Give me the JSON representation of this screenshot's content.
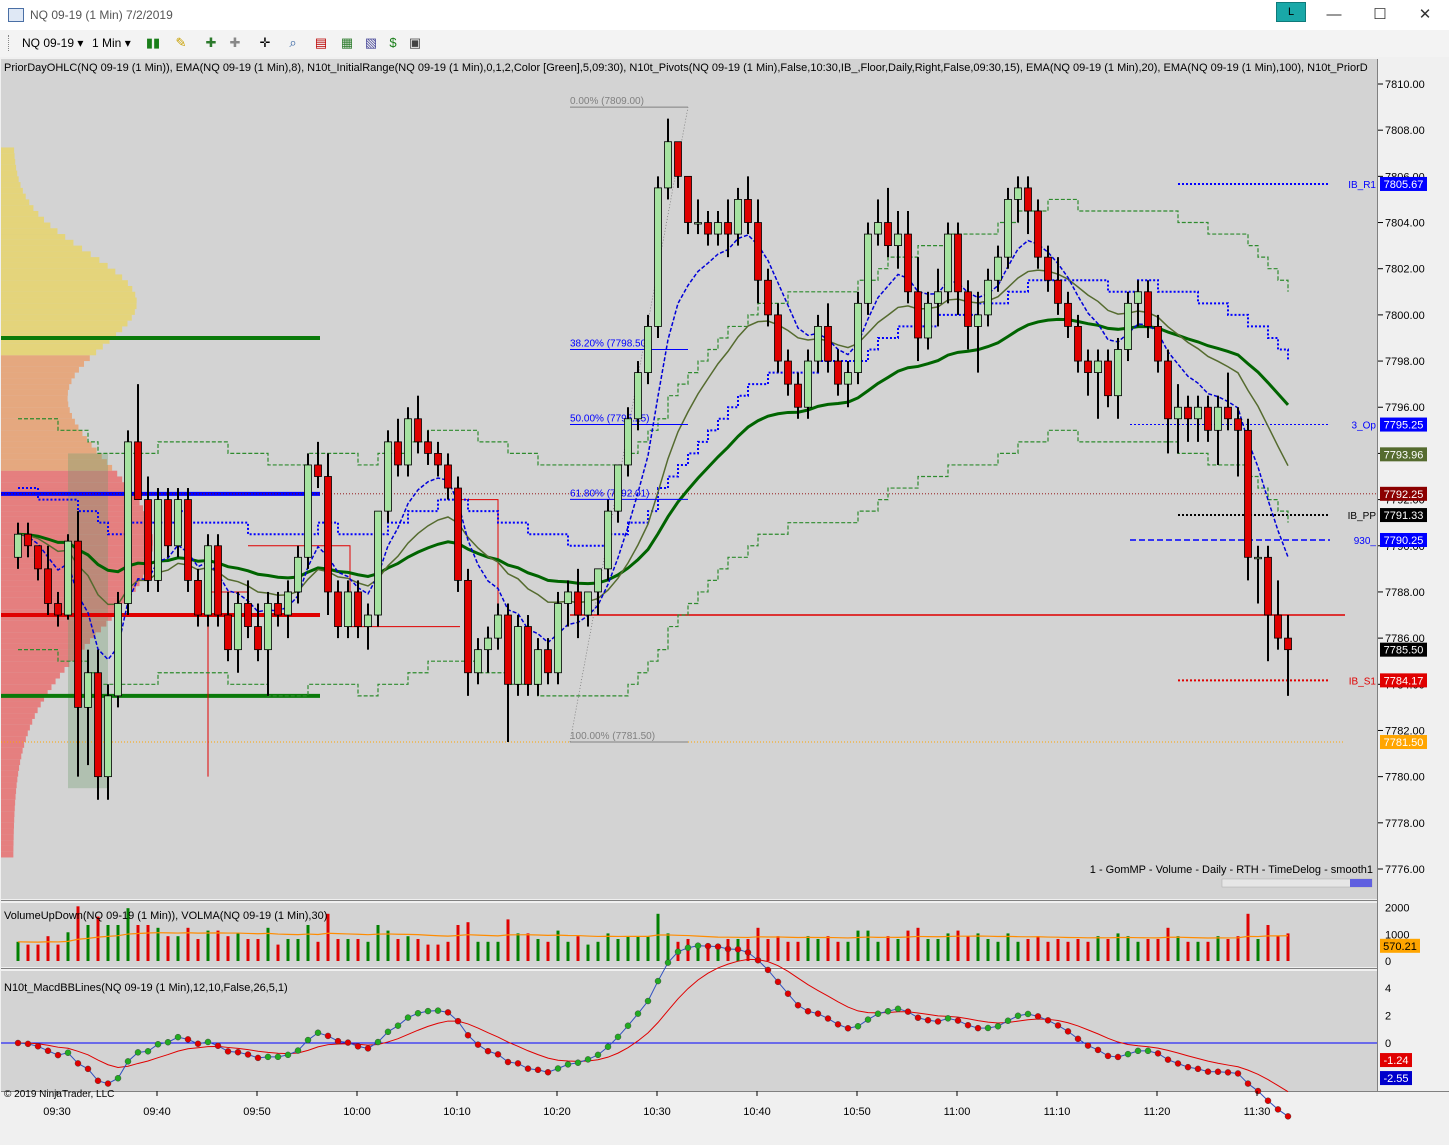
{
  "window": {
    "title": "NQ 09-19 (1 Min)  7/2/2019",
    "link_label": "L",
    "minimize": "—",
    "maximize": "☐",
    "close": "✕"
  },
  "toolbar": {
    "instrument": "NQ 09-19",
    "interval": "1 Min"
  },
  "indicators": {
    "price_panel": "PriorDayOHLC(NQ 09-19 (1 Min)), EMA(NQ 09-19 (1 Min),8), N10t_InitialRange(NQ 09-19 (1 Min),0,1,2,Color [Green],5,09:30), N10t_Pivots(NQ 09-19 (1 Min),False,10:30,IB_,Floor,Daily,Right,False,09:30,15), EMA(NQ 09-19 (1 Min),20), EMA(NQ 09-19 (1 Min),100), N10t_PriorD",
    "volume_panel": "VolumeUpDown(NQ 09-19 (1 Min)), VOLMA(NQ 09-19 (1 Min),30)",
    "macd_panel": "N10t_MacdBBLines(NQ 09-19 (1 Min),12,10,False,26,5,1)"
  },
  "profile_label": "1 - GomMP - Volume - Daily - RTH - TimeDelog - smooth1",
  "copyright": "© 2019 NinjaTrader, LLC",
  "colors": {
    "up": "#a6e3a1",
    "down": "#e00000",
    "ema8": "#0000d8",
    "ema20": "#556b2f",
    "ema100": "#006400",
    "bg": "#d3d3d3"
  },
  "chart_data": {
    "type": "candlestick",
    "x_labels": [
      "09:30",
      "09:40",
      "09:50",
      "10:00",
      "10:10",
      "10:20",
      "10:30",
      "10:40",
      "10:50",
      "11:00",
      "11:10",
      "11:20",
      "11:30"
    ],
    "y_ticks": [
      "7810.00",
      "7808.00",
      "7806.00",
      "7804.00",
      "7802.00",
      "7800.00",
      "7798.00",
      "7796.00",
      "7794.00",
      "7792.00",
      "7790.00",
      "7788.00",
      "7786.00",
      "7784.00",
      "7782.00",
      "7780.00",
      "7778.00",
      "7776.00"
    ],
    "ylim": [
      7775.7,
      7810.9
    ],
    "last_price": 7785.5,
    "fib_levels": [
      {
        "label": "0.00% (7809.00)",
        "price": 7809.0
      },
      {
        "label": "38.20% (7798.50)",
        "price": 7798.5
      },
      {
        "label": "50.00% (7795.25)",
        "price": 7795.25
      },
      {
        "label": "61.80% (7792.01)",
        "price": 7792.01
      },
      {
        "label": "100.00% (7781.50)",
        "price": 7781.5
      }
    ],
    "pivot_levels": [
      {
        "name": "IB_R1",
        "price": 7805.67,
        "label": "7805.67",
        "color": "#0000ff"
      },
      {
        "name": "3_Op",
        "price": 7795.25,
        "label": "7795.25",
        "color": "#0000ff"
      },
      {
        "name": "",
        "price": 7793.96,
        "label": "7793.96",
        "color": "#556b2f"
      },
      {
        "name": "",
        "price": 7792.25,
        "label": "7792.25",
        "color": "#8b0000"
      },
      {
        "name": "IB_PP",
        "price": 7791.33,
        "label": "7791.33",
        "color": "#000000"
      },
      {
        "name": "930_",
        "price": 7790.25,
        "label": "7790.25",
        "color": "#0000ff"
      },
      {
        "name": "",
        "price": 7785.5,
        "label": "7785.50",
        "color": "#000000"
      },
      {
        "name": "IB_S1",
        "price": 7784.17,
        "label": "7784.17",
        "color": "#e00000"
      },
      {
        "name": "",
        "price": 7781.5,
        "label": "7781.50",
        "color": "#ffa500"
      }
    ],
    "candles": [
      [
        7789.5,
        7791,
        7789,
        7790.5
      ],
      [
        7790.5,
        7791,
        7789.5,
        7790
      ],
      [
        7790,
        7790,
        7788.5,
        7789
      ],
      [
        7789,
        7790,
        7787,
        7787.5
      ],
      [
        7787.5,
        7788,
        7786.5,
        7787
      ],
      [
        7787,
        7790.5,
        7786.8,
        7790.2
      ],
      [
        7790.2,
        7791.5,
        7780,
        7783
      ],
      [
        7783,
        7785.5,
        7780.5,
        7784.5
      ],
      [
        7784.5,
        7785.5,
        7779,
        7780
      ],
      [
        7780,
        7784,
        7779,
        7783.5
      ],
      [
        7783.5,
        7788,
        7783,
        7787.5
      ],
      [
        7787.5,
        7795,
        7787,
        7794.5
      ],
      [
        7794.5,
        7797,
        7792,
        7792
      ],
      [
        7792,
        7793,
        7788,
        7788.5
      ],
      [
        7788.5,
        7792.5,
        7788,
        7792
      ],
      [
        7792,
        7792.5,
        7789.5,
        7790
      ],
      [
        7790,
        7792.5,
        7789.5,
        7792
      ],
      [
        7792,
        7792.5,
        7788,
        7788.5
      ],
      [
        7788.5,
        7789,
        7786.5,
        7787
      ],
      [
        7787,
        7790.5,
        7786.5,
        7790
      ],
      [
        7790,
        7790.5,
        7786.5,
        7787
      ],
      [
        7787,
        7788,
        7785,
        7785.5
      ],
      [
        7785.5,
        7788,
        7784.5,
        7787.5
      ],
      [
        7787.5,
        7788.5,
        7786,
        7786.5
      ],
      [
        7786.5,
        7787.5,
        7785,
        7785.5
      ],
      [
        7785.5,
        7788,
        7783.5,
        7787.5
      ],
      [
        7787.5,
        7788,
        7786.5,
        7787
      ],
      [
        7787,
        7788.5,
        7786,
        7788
      ],
      [
        7788,
        7790,
        7787.5,
        7789.5
      ],
      [
        7789.5,
        7794,
        7789,
        7793.5
      ],
      [
        7793.5,
        7794.5,
        7792.5,
        7793
      ],
      [
        7793,
        7794,
        7787,
        7788
      ],
      [
        7788,
        7788.5,
        7786,
        7786.5
      ],
      [
        7786.5,
        7788.5,
        7786,
        7788
      ],
      [
        7788,
        7788.5,
        7786,
        7786.5
      ],
      [
        7786.5,
        7787.5,
        7785.5,
        7787
      ],
      [
        7787,
        7791.5,
        7786.5,
        7791.5
      ],
      [
        7791.5,
        7795,
        7791,
        7794.5
      ],
      [
        7794.5,
        7795.5,
        7793,
        7793.5
      ],
      [
        7793.5,
        7796,
        7793,
        7795.5
      ],
      [
        7795.5,
        7796.5,
        7794,
        7794.5
      ],
      [
        7794.5,
        7795,
        7793.5,
        7794
      ],
      [
        7794,
        7794.5,
        7793,
        7793.5
      ],
      [
        7793.5,
        7794,
        7792,
        7792.5
      ],
      [
        7792.5,
        7793,
        7788,
        7788.5
      ],
      [
        7788.5,
        7789,
        7783.5,
        7784.5
      ],
      [
        7784.5,
        7786,
        7784,
        7785.5
      ],
      [
        7785.5,
        7786.5,
        7784.5,
        7786
      ],
      [
        7786,
        7787.5,
        7785.5,
        7787
      ],
      [
        7787,
        7787.5,
        7781.5,
        7784
      ],
      [
        7784,
        7787,
        7783.5,
        7786.5
      ],
      [
        7786.5,
        7787,
        7783.5,
        7784
      ],
      [
        7784,
        7786,
        7783.5,
        7785.5
      ],
      [
        7785.5,
        7786,
        7784,
        7784.5
      ],
      [
        7784.5,
        7788,
        7784,
        7787.5
      ],
      [
        7787.5,
        7788.5,
        7786.5,
        7788
      ],
      [
        7788,
        7789,
        7786,
        7787
      ],
      [
        7787,
        7788,
        7786.5,
        7788
      ],
      [
        7788,
        7789,
        7787,
        7789
      ],
      [
        7789,
        7792,
        7788.5,
        7791.5
      ],
      [
        7791.5,
        7793.5,
        7791,
        7793.5
      ],
      [
        7793.5,
        7796,
        7793,
        7795.5
      ],
      [
        7795.5,
        7798,
        7795,
        7797.5
      ],
      [
        7797.5,
        7800,
        7797,
        7799.5
      ],
      [
        7799.5,
        7806,
        7799,
        7805.5
      ],
      [
        7805.5,
        7808.5,
        7805,
        7807.5
      ],
      [
        7807.5,
        7807.5,
        7805.5,
        7806
      ],
      [
        7806,
        7806,
        7803.5,
        7804
      ],
      [
        7804,
        7805,
        7803.5,
        7804
      ],
      [
        7804,
        7804.5,
        7803,
        7803.5
      ],
      [
        7803.5,
        7804.5,
        7803,
        7804
      ],
      [
        7804,
        7805,
        7802.5,
        7803.5
      ],
      [
        7803.5,
        7805.5,
        7803,
        7805
      ],
      [
        7805,
        7806,
        7803.5,
        7804
      ],
      [
        7804,
        7805,
        7800.5,
        7801.5
      ],
      [
        7801.5,
        7802,
        7799.5,
        7800
      ],
      [
        7800,
        7800.5,
        7797.5,
        7798
      ],
      [
        7798,
        7798.5,
        7796.5,
        7797
      ],
      [
        7797,
        7797.5,
        7795.5,
        7796
      ],
      [
        7796,
        7798.5,
        7795.5,
        7798
      ],
      [
        7798,
        7800,
        7797.5,
        7799.5
      ],
      [
        7799.5,
        7800.5,
        7797.5,
        7798
      ],
      [
        7798,
        7798.5,
        7796.5,
        7797
      ],
      [
        7797,
        7798,
        7796,
        7797.5
      ],
      [
        7797.5,
        7801,
        7797,
        7800.5
      ],
      [
        7800.5,
        7804,
        7800,
        7803.5
      ],
      [
        7803.5,
        7805,
        7803,
        7804
      ],
      [
        7804,
        7805.5,
        7802.5,
        7803
      ],
      [
        7803,
        7804.5,
        7802,
        7803.5
      ],
      [
        7803.5,
        7804.5,
        7800.5,
        7801
      ],
      [
        7801,
        7802.5,
        7798,
        7799
      ],
      [
        7799,
        7801,
        7798.5,
        7800.5
      ],
      [
        7800.5,
        7802,
        7799.5,
        7801
      ],
      [
        7801,
        7804,
        7800.5,
        7803.5
      ],
      [
        7803.5,
        7804,
        7800,
        7801
      ],
      [
        7801,
        7801.5,
        7798.5,
        7799.5
      ],
      [
        7799.5,
        7801,
        7797.5,
        7800
      ],
      [
        7800,
        7802,
        7799.5,
        7801.5
      ],
      [
        7801.5,
        7803,
        7801,
        7802.5
      ],
      [
        7802.5,
        7805.5,
        7802,
        7805
      ],
      [
        7805,
        7806,
        7804,
        7805.5
      ],
      [
        7805.5,
        7806,
        7803.5,
        7804.5
      ],
      [
        7804.5,
        7805,
        7802,
        7802.5
      ],
      [
        7802.5,
        7803,
        7801,
        7801.5
      ],
      [
        7801.5,
        7802.5,
        7800,
        7800.5
      ],
      [
        7800.5,
        7801,
        7799,
        7799.5
      ],
      [
        7799.5,
        7800,
        7797.5,
        7798
      ],
      [
        7798,
        7798.5,
        7796.5,
        7797.5
      ],
      [
        7797.5,
        7798.5,
        7795.5,
        7798
      ],
      [
        7798,
        7798.5,
        7796,
        7796.5
      ],
      [
        7796.5,
        7799,
        7795.5,
        7798.5
      ],
      [
        7798.5,
        7801,
        7798,
        7800.5
      ],
      [
        7800.5,
        7801.5,
        7799.5,
        7801
      ],
      [
        7801,
        7801.5,
        7799,
        7799.5
      ],
      [
        7799.5,
        7800,
        7797.5,
        7798
      ],
      [
        7798,
        7798.5,
        7794,
        7795.5
      ],
      [
        7795.5,
        7797,
        7794,
        7796
      ],
      [
        7796,
        7796.5,
        7794.5,
        7795.5
      ],
      [
        7795.5,
        7796.5,
        7794.5,
        7796
      ],
      [
        7796,
        7796.5,
        7794.5,
        7795
      ],
      [
        7795,
        7796.5,
        7793.5,
        7796
      ],
      [
        7796,
        7797.5,
        7795,
        7795.5
      ],
      [
        7795.5,
        7796,
        7793,
        7795
      ],
      [
        7795,
        7795.5,
        7788.5,
        7789.5
      ],
      [
        7789.5,
        7790,
        7787.5,
        7789.5
      ],
      [
        7789.5,
        7790,
        7785,
        7787
      ],
      [
        7787,
        7788.5,
        7785.5,
        7786
      ],
      [
        7786,
        7787,
        7783.5,
        7785.5
      ]
    ],
    "volume": {
      "ylim": [
        0,
        2100
      ],
      "y_ticks": [
        "2000",
        "1000",
        "0"
      ],
      "vma_label": "570.21"
    },
    "macd": {
      "ylim": [
        -3.2,
        4.8
      ],
      "y_ticks": [
        "4",
        "2",
        "0"
      ],
      "macd_value": "-2.55",
      "signal_value": "-1.24"
    }
  }
}
